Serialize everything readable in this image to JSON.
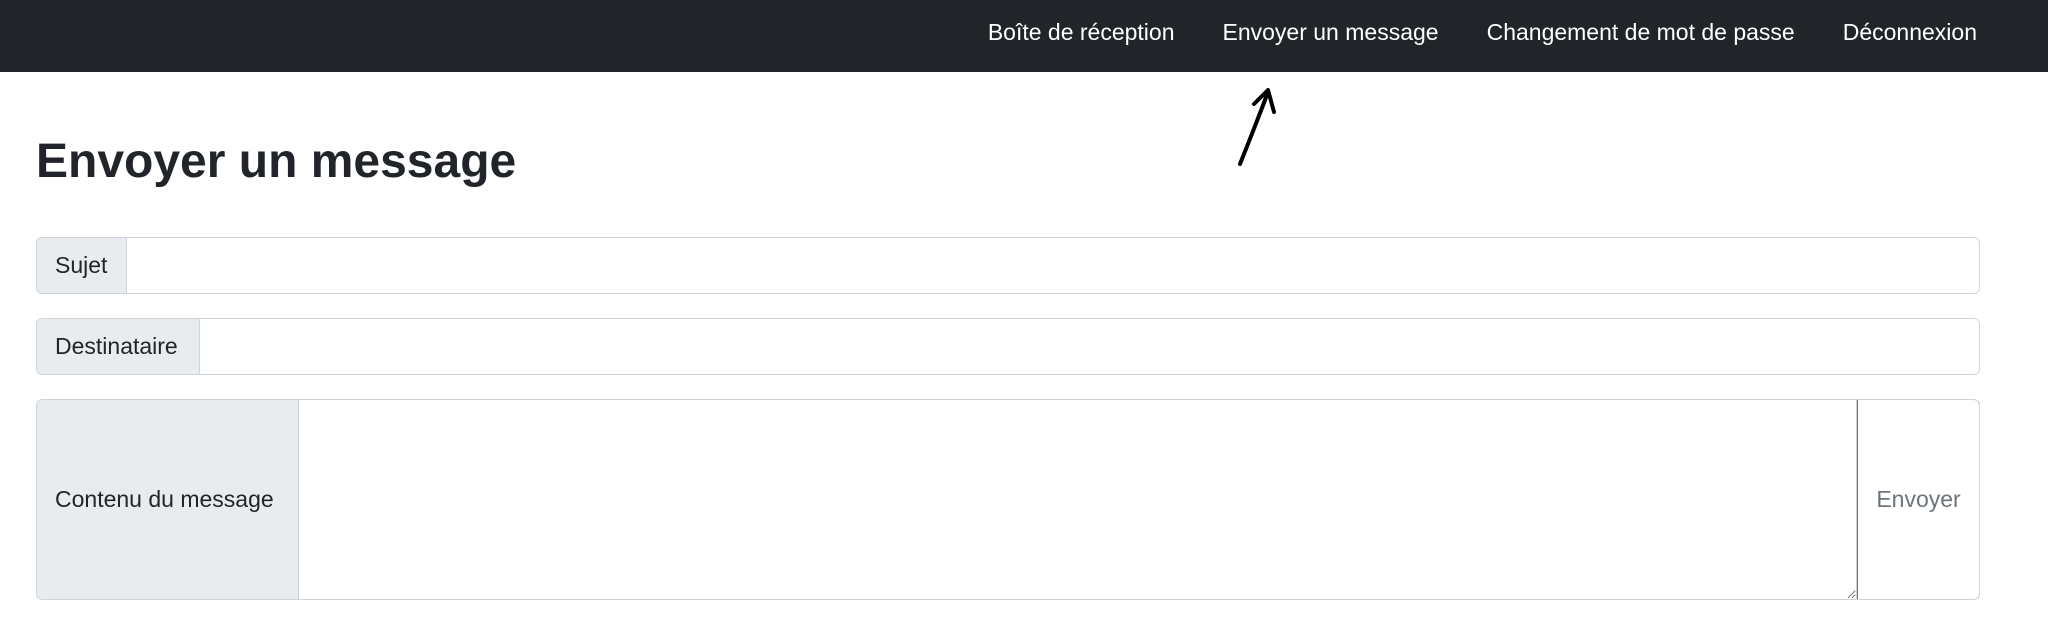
{
  "nav": {
    "items": [
      {
        "label": "Boîte de réception"
      },
      {
        "label": "Envoyer un message"
      },
      {
        "label": "Changement de mot de passe"
      },
      {
        "label": "Déconnexion"
      }
    ]
  },
  "page": {
    "title": "Envoyer un message"
  },
  "form": {
    "subject_label": "Sujet",
    "subject_value": "",
    "recipient_label": "Destinataire",
    "recipient_value": "",
    "content_label": "Contenu du message",
    "content_value": "",
    "send_label": "Envoyer"
  },
  "colors": {
    "navbar_bg": "#212529",
    "addon_bg": "#e9ecef",
    "border": "#ced4da",
    "button_text": "#6c757d"
  },
  "annotation": {
    "icon": "hand-drawn-arrow-icon"
  }
}
